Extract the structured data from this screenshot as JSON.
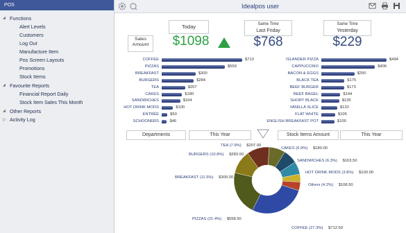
{
  "sidebar": {
    "header": "POS",
    "sections": [
      {
        "label": "Functions",
        "items": [
          "Alert Levels",
          "Customers",
          "Log Out",
          "Manufacture Item",
          "Pos Screen Layouts",
          "Promotions",
          "Stock Items"
        ]
      },
      {
        "label": "Favourite Reports",
        "items": [
          "Financial Report Daily",
          "Stock Item Sales This Month"
        ]
      },
      {
        "label": "Other Reports",
        "items": []
      },
      {
        "label": "Activity Log",
        "items": []
      }
    ]
  },
  "topbar": {
    "title": "Idealpos user",
    "icons": [
      "gear-icon",
      "refresh-icon",
      "mail-icon",
      "print-icon",
      "save-icon",
      "close-icon"
    ]
  },
  "kpi": {
    "sales_amount_label": "Sales Amount",
    "today": {
      "label": "Today",
      "value": "$1098",
      "trend": "up",
      "color": "#2ea043"
    },
    "last_friday": {
      "label_top": "Same Time",
      "label_bottom": "Last Friday",
      "value": "$768",
      "color": "#34497f"
    },
    "yesterday": {
      "label_top": "Same Time",
      "label_bottom": "Yesterday",
      "value": "$229",
      "color": "#34497f"
    }
  },
  "chart_data": [
    {
      "type": "bar",
      "orientation": "horizontal",
      "categories": [
        "COFFEE",
        "PIZZAS",
        "BREAKFAST",
        "BURGERS",
        "TEA",
        "CAKES",
        "SANDWICHES",
        "HOT DRINK MODS",
        "ENTRÉE",
        "SCHOONERS"
      ],
      "values": [
        713,
        559,
        300,
        284,
        207,
        180,
        164,
        100,
        50,
        46
      ],
      "value_labels": [
        "$713",
        "$559",
        "$300",
        "$284",
        "$207",
        "$180",
        "$164",
        "$100",
        "$50",
        "$46"
      ],
      "xlim": [
        0,
        713
      ]
    },
    {
      "type": "bar",
      "orientation": "horizontal",
      "categories": [
        "ISLANDER PIZZA",
        "CAPPUCCINO",
        "BACON & EGGS",
        "BLACK TEA",
        "BEEF BURGER",
        "BEEF BAGEL",
        "SHORT BLACK",
        "VANILLA SLICE",
        "FLAT WHITE",
        "ENGLISH BREAKFAST POT"
      ],
      "values": [
        494,
        406,
        250,
        175,
        173,
        144,
        135,
        120,
        105,
        100
      ],
      "value_labels": [
        "$494",
        "$406",
        "$250",
        "$175",
        "$173",
        "$144",
        "$135",
        "$120",
        "$105",
        "$100"
      ],
      "xlim": [
        0,
        494
      ]
    },
    {
      "type": "pie",
      "style": "donut",
      "slices": [
        {
          "label": "COFFEE (27.3%)",
          "amount": "$712.50",
          "value": 712.5,
          "color": "#2e4aa5"
        },
        {
          "label": "PIZZAS (21.4%)",
          "amount": "$558.50",
          "value": 558.5,
          "color": "#4f5a1c"
        },
        {
          "label": "BREAKFAST (11.5%)",
          "amount": "$300.00",
          "value": 300.0,
          "color": "#8a7a1a"
        },
        {
          "label": "BURGERS (10.8%)",
          "amount": "$283.50",
          "value": 283.5,
          "color": "#6f2f1f"
        },
        {
          "label": "TEA (7.9%)",
          "amount": "$207.00",
          "value": 207.0,
          "color": "#6a6a2a"
        },
        {
          "label": "CAKES (6.9%)",
          "amount": "$180.00",
          "value": 180.0,
          "color": "#1f4a6a"
        },
        {
          "label": "SANDWICHES (6.3%)",
          "amount": "$163.50",
          "value": 163.5,
          "color": "#2f8aa5"
        },
        {
          "label": "HOT DRINK MODS (3.8%)",
          "amount": "$100.00",
          "value": 100.0,
          "color": "#c9b12a"
        },
        {
          "label": "Others (4.2%)",
          "amount": "$108.50",
          "value": 108.5,
          "color": "#b7432a"
        }
      ]
    }
  ],
  "selectors": {
    "left_group": "Departments",
    "left_period": "This Year",
    "right_group": "Stock Items Amount",
    "right_period": "This Year"
  }
}
